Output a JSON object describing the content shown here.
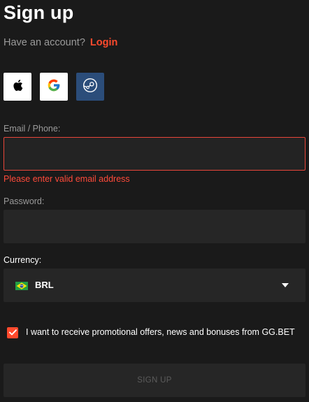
{
  "header": {
    "title": "Sign up",
    "have_account_text": "Have an account?",
    "login_link": "Login"
  },
  "social": [
    {
      "name": "apple",
      "icon": "apple-icon"
    },
    {
      "name": "google",
      "icon": "google-icon"
    },
    {
      "name": "steam",
      "icon": "steam-icon"
    }
  ],
  "form": {
    "email": {
      "label": "Email / Phone:",
      "value": "",
      "placeholder": "",
      "error": "Please enter valid email address"
    },
    "password": {
      "label": "Password:",
      "value": "",
      "placeholder": ""
    },
    "currency": {
      "label": "Currency:",
      "selected": "BRL",
      "flag": "brazil-flag-icon"
    },
    "promo_checkbox": {
      "checked": true,
      "label": "I want to receive promotional offers, news and bonuses from GG.BET"
    },
    "submit_label": "SIGN UP"
  },
  "colors": {
    "background": "#1a1a1a",
    "field_bg": "#262626",
    "accent": "#ff4a2d",
    "error": "#ff4a3a",
    "muted_text": "#9a9a9a",
    "disabled_text": "#5c5c5c",
    "steam_bg": "#2b4d7a"
  }
}
